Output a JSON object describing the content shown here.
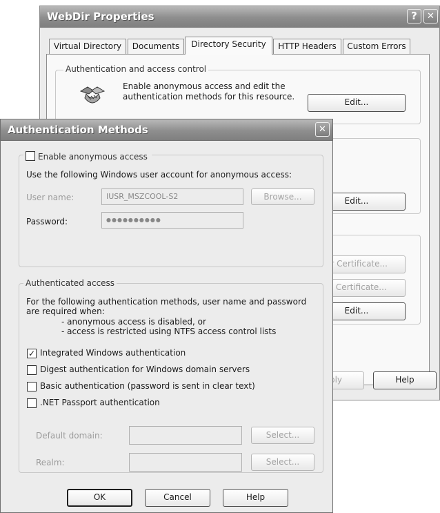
{
  "webdir": {
    "title": "WebDir Properties",
    "help_glyph": "?",
    "close_glyph": "✕",
    "tabs": [
      "Virtual Directory",
      "Documents",
      "Directory Security",
      "HTTP Headers",
      "Custom Errors"
    ],
    "auth_group_legend": "Authentication and access control",
    "auth_text": "Enable anonymous access and edit the authentication methods for this resource.",
    "edit_label": "Edit...",
    "server_certificate_label": "er Certificate...",
    "view_certificate_label": "w Certificate...",
    "apply_label": "ply",
    "help_label": "Help"
  },
  "auth_methods": {
    "title": "Authentication Methods",
    "close_glyph": "✕",
    "anonymous": {
      "checkbox_label": "Enable anonymous access",
      "checked": false,
      "description": "Use the following Windows user account for anonymous access:",
      "username_label": "User name:",
      "username_value": "IUSR_MSZCOOL-S2",
      "browse_label": "Browse...",
      "password_label": "Password:",
      "password_value": "●●●●●●●●●●"
    },
    "authenticated": {
      "legend": "Authenticated access",
      "description": "For the following authentication methods, user name and password are required when:",
      "bullet_1": "- anonymous access is disabled, or",
      "bullet_2": "- access is restricted using NTFS access control lists",
      "options": [
        {
          "label": "Integrated Windows authentication",
          "checked": true
        },
        {
          "label": "Digest authentication for Windows domain servers",
          "checked": false
        },
        {
          "label": "Basic authentication (password is sent in clear text)",
          "checked": false
        },
        {
          "label": ".NET Passport authentication",
          "checked": false
        }
      ],
      "default_domain_label": "Default domain:",
      "realm_label": "Realm:",
      "select_label": "Select..."
    },
    "ok_label": "OK",
    "cancel_label": "Cancel",
    "help_label": "Help"
  }
}
